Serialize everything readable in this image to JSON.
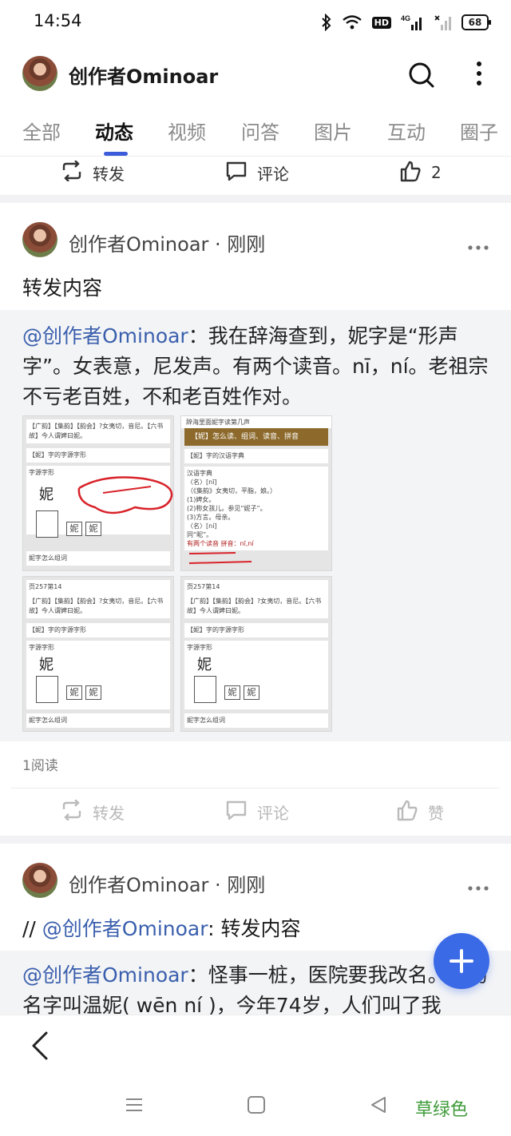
{
  "status_bar": {
    "time": "14:54",
    "network_label": "4G",
    "hd_label": "HD",
    "battery": "68"
  },
  "header": {
    "profile_name": "创作者Ominoar"
  },
  "tabs": [
    {
      "label": "全部"
    },
    {
      "label": "动态"
    },
    {
      "label": "视频"
    },
    {
      "label": "问答"
    },
    {
      "label": "图片"
    },
    {
      "label": "互动"
    },
    {
      "label": "圈子"
    }
  ],
  "top_actions": {
    "repost": "转发",
    "comment": "评论",
    "like_count": "2"
  },
  "post1": {
    "author_line": "创作者Ominoar · 刚刚",
    "text": "转发内容",
    "quote_mention": "@创作者Ominoar",
    "quote_body": "：我在辞海查到，妮字是“形声字”。女表意，尼发声。有两个读音。nī，ní。老祖宗不亏老百姓，不和老百姓作对。",
    "reads": "1阅读",
    "actions": {
      "repost": "转发",
      "comment": "评论",
      "like": "赞"
    },
    "thumbs": {
      "t1_line1": "【广韵】【集韵】【韵会】?女夷切，音尼。【六书故】今人谓婢曰妮。",
      "t1_sec1": "【妮】字的字源字形",
      "t1_sec1b": "字源字形",
      "t1_char": "妮",
      "t1_foot": "妮字怎么组词",
      "t2_topbar": "辞海里面妮字读第几声",
      "t2_bar": "【妮】怎么读、组词、读音、拼音",
      "t2_sec": "【妮】字的汉语字典",
      "t2_body1": "汉语字典",
      "t2_body2": "〈名〉[nī]",
      "t2_body3": "（《集韵》女夷切，平脂，娘。）",
      "t2_body4": "(1)婢女。",
      "t2_body5": "(2)称女孩儿。参见“妮子”。",
      "t2_body6": "(3)方言。母亲。",
      "t2_body7": "〈名〉[ní]",
      "t2_body8": "同“昵”。",
      "t2_body9": "有两个读音 拼音：nī,ní",
      "t3_head": "页257第14",
      "t3_line1": "【广韵】【集韵】【韵会】?女夷切，音尼。【六书故】今人谓婢曰妮。",
      "t3_sec": "【妮】字的字源字形",
      "t3_sec2": "字源字形",
      "t3_char": "妮",
      "t3_foot": "妮字怎么组词",
      "t4_head": "页257第14",
      "t4_line1": "【广韵】【集韵】【韵会】?女夷切，音尼。【六书故】今人谓婢曰妮。",
      "t4_sec": "【妮】字的字源字形",
      "t4_sec2": "字源字形",
      "t4_char": "妮",
      "t4_foot": "妮字怎么组词"
    }
  },
  "post2": {
    "author_line": "创作者Ominoar · 刚刚",
    "text_prefix": "// ",
    "text_mention": "@创作者Ominoar",
    "text_rest": ": 转发内容",
    "quote_mention": "@创作者Ominoar",
    "quote_body": "：怪事一桩，医院要我改名。我的名字叫温妮( wēn  ní )，今年74岁，人们叫了我"
  },
  "watermark": "草绿色",
  "colors": {
    "accent": "#3b6ae6",
    "mention": "#3a5fad",
    "tab_indicator": "#3b5bdb",
    "watermark": "#3f9b3a"
  },
  "icons": [
    "bluetooth-icon",
    "wifi-icon",
    "signal-icon",
    "battery-icon",
    "search-icon",
    "more-vertical-icon",
    "repost-icon",
    "comment-icon",
    "like-icon",
    "more-horizontal-icon",
    "plus-icon",
    "back-icon",
    "menu-icon",
    "home-icon",
    "triangle-back-icon"
  ]
}
